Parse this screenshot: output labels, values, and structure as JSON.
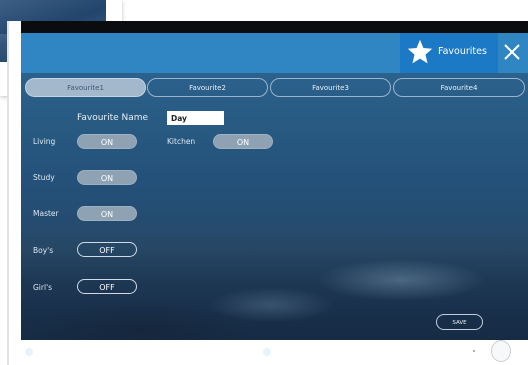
{
  "header": {
    "favourites_label": "Favourites",
    "star_icon": "star-icon",
    "close_icon": "close-icon",
    "accent_color": "#2f86c3",
    "active_tab_color": "#1c79c5"
  },
  "tabs": [
    {
      "label": "Favourite1",
      "active": true
    },
    {
      "label": "Favourite2",
      "active": false
    },
    {
      "label": "Favourite3",
      "active": false
    },
    {
      "label": "Favourite4",
      "active": false
    }
  ],
  "form": {
    "name_label": "Favourite Name",
    "name_value": "Day"
  },
  "rooms": [
    {
      "label": "Living",
      "state": "ON"
    },
    {
      "label": "Kitchen",
      "state": "ON"
    },
    {
      "label": "Study",
      "state": "ON"
    },
    {
      "label": "Master",
      "state": "ON"
    },
    {
      "label": "Boy's",
      "state": "OFF"
    },
    {
      "label": "Girl's",
      "state": "OFF"
    }
  ],
  "save_label": "SAVE"
}
